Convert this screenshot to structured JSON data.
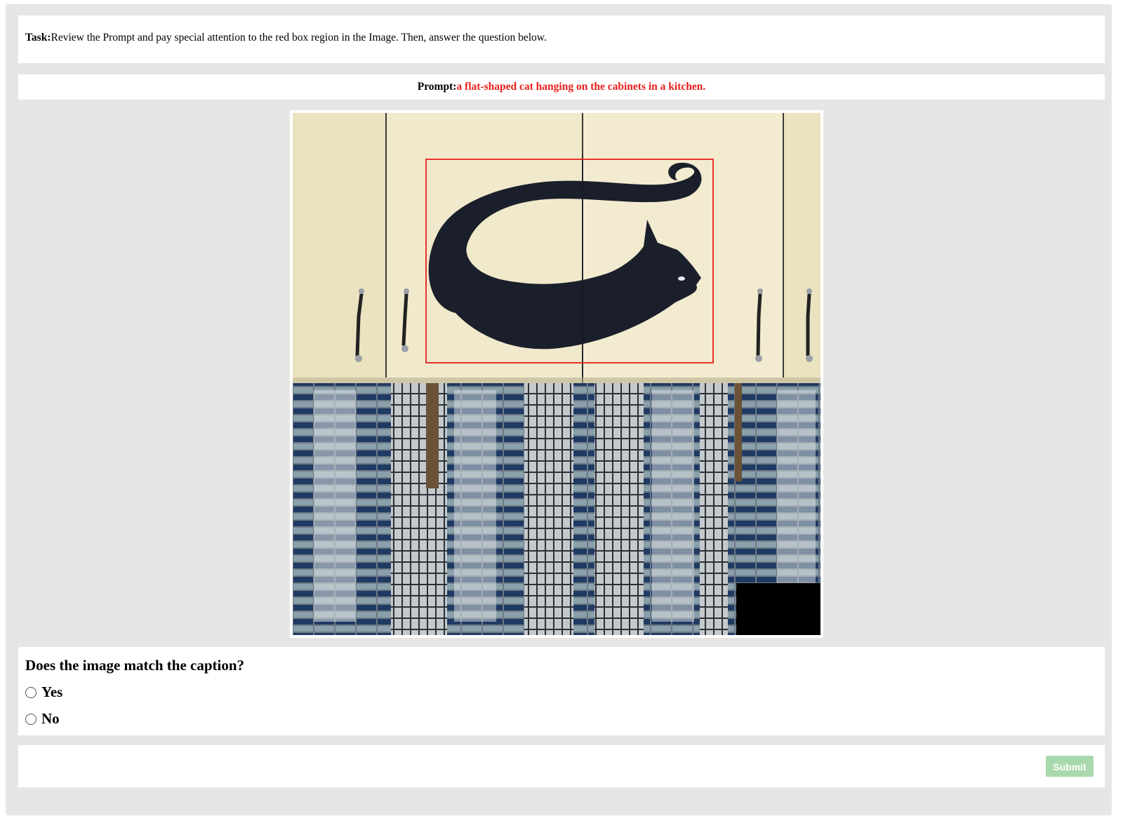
{
  "task": {
    "label": "Task:",
    "text": "Review the Prompt and pay special attention to the red box region in the Image. Then, answer the question below."
  },
  "prompt": {
    "label": "Prompt:",
    "caption": "a flat-shaped cat hanging on the cabinets in a kitchen.",
    "caption_color": "#e8201b"
  },
  "image": {
    "highlight_box_color": "#e8201b"
  },
  "question": {
    "title": "Does the image match the caption?",
    "options": [
      {
        "label": "Yes",
        "selected": false
      },
      {
        "label": "No",
        "selected": false
      }
    ]
  },
  "submit": {
    "label": "Submit",
    "enabled": false,
    "color": "#a9d8ad"
  }
}
